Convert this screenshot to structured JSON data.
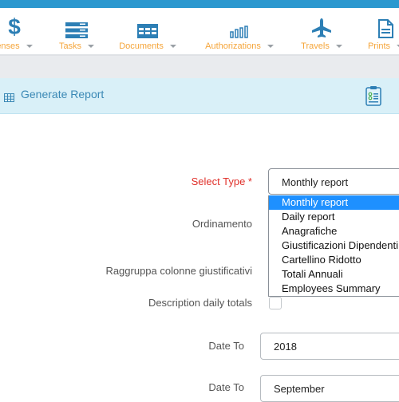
{
  "nav": {
    "items": [
      {
        "label": "enses",
        "icon": "dollar-icon"
      },
      {
        "label": "Tasks",
        "icon": "tasks-icon"
      },
      {
        "label": "Documents",
        "icon": "table-icon"
      },
      {
        "label": "Authorizations",
        "icon": "bar-chart-icon"
      },
      {
        "label": "Travels",
        "icon": "plane-icon"
      },
      {
        "label": "Prints",
        "icon": "document-icon"
      }
    ]
  },
  "header": {
    "title": "Generate Report"
  },
  "form": {
    "select_type_label": "Select Type *",
    "select_type_value": "Monthly report",
    "select_type_options": [
      "Monthly report",
      "Daily report",
      "Anagrafiche",
      "Giustificazioni Dipendenti",
      "Cartellino Ridotto",
      "Totali Annuali",
      "Employees Summary"
    ],
    "ordinamento_label": "Ordinamento",
    "raggruppa_label": "Raggruppa colonne giustificativi",
    "description_daily_label": "Description daily totals",
    "date_to_year_label": "Date To",
    "date_to_year_value": "2018",
    "date_to_month_label": "Date To",
    "date_to_month_value": "September"
  },
  "colors": {
    "accent": "#2b98cf",
    "nav_label": "#f5a53a",
    "required": "#e0302a",
    "selected_option": "#1e90ff"
  }
}
